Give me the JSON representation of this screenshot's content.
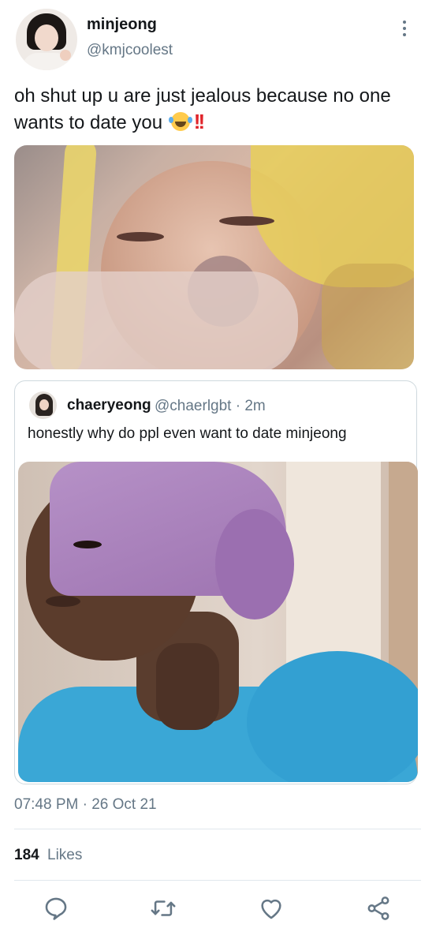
{
  "author": {
    "name": "minjeong",
    "handle": "@kmjcoolest"
  },
  "tweet": {
    "text": "oh shut up u are just jealous because no one wants to date you"
  },
  "quoted": {
    "name": "chaeryeong",
    "handle": "@chaerlgbt · 2m",
    "text": "honestly why do ppl even want to date minjeong"
  },
  "meta": {
    "timestamp": "07:48 PM · 26 Oct 21",
    "likes_count": "184",
    "likes_label": "Likes"
  },
  "icons": {
    "more": "more-vertical-icon",
    "reply": "reply-icon",
    "retweet": "retweet-icon",
    "like": "heart-icon",
    "share": "share-icon"
  },
  "colors": {
    "primary_text": "#14171a",
    "secondary_text": "#657786",
    "border": "#cfd9de"
  }
}
